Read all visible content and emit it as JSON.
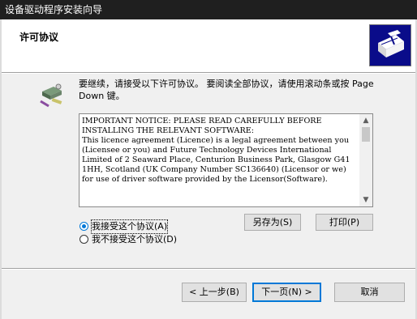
{
  "window": {
    "title": "设备驱动程序安装向导"
  },
  "header": {
    "title": "许可协议",
    "logo_icon": "installer-logo-icon"
  },
  "instruction": {
    "text": "要继续，请接受以下许可协议。 要阅读全部协议，请使用滚动条或按 Page Down 键。",
    "icon": "installer-tools-icon"
  },
  "license": {
    "text": "IMPORTANT NOTICE: PLEASE READ CAREFULLY BEFORE INSTALLING THE RELEVANT SOFTWARE:\nThis licence agreement (Licence) is a legal agreement between you (Licensee or you) and Future Technology Devices International Limited of 2 Seaward Place, Centurion Business Park, Glasgow G41 1HH, Scotland (UK Company Number SC136640) (Licensor or we) for use of driver software provided by the Licensor(Software)."
  },
  "buttons": {
    "save_as": "另存为(S)",
    "print": "打印(P)",
    "back": "< 上一步(B)",
    "next": "下一页(N) >",
    "cancel": "取消"
  },
  "options": {
    "accept": "我接受这个协议(A)",
    "decline": "我不接受这个协议(D)",
    "selected": "accept"
  },
  "colors": {
    "title_bar": "#1f1f1f",
    "logo_bg": "#0a0c8a",
    "focus": "#0078d7"
  }
}
